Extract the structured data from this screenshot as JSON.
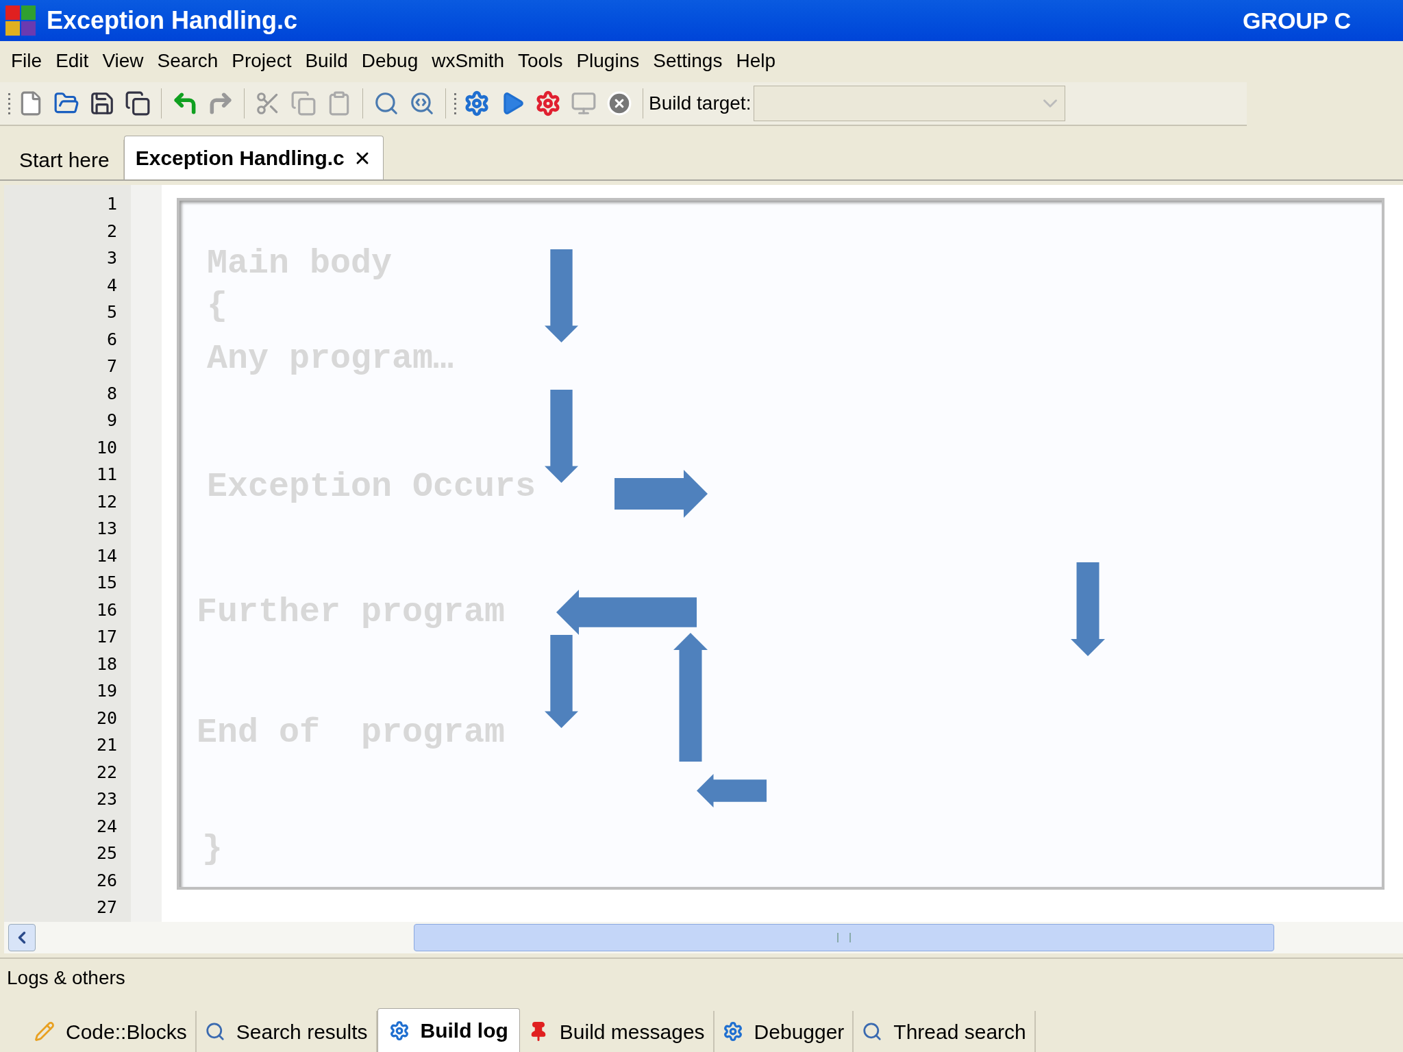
{
  "window": {
    "title": "Exception Handling.c",
    "overlay_title": "GROUP C"
  },
  "menu": [
    "File",
    "Edit",
    "View",
    "Search",
    "Project",
    "Build",
    "Debug",
    "wxSmith",
    "Tools",
    "Plugins",
    "Settings",
    "Help"
  ],
  "toolbar": {
    "build_target_label": "Build target:"
  },
  "editor_tabs": [
    {
      "label": "Start here",
      "selected": false
    },
    {
      "label": "Exception Handling.c",
      "selected": true
    }
  ],
  "line_numbers": [
    "1",
    "2",
    "3",
    "4",
    "5",
    "6",
    "7",
    "8",
    "9",
    "10",
    "11",
    "12",
    "13",
    "14",
    "15",
    "16",
    "17",
    "18",
    "19",
    "20",
    "21",
    "22",
    "23",
    "24",
    "25",
    "26",
    "27"
  ],
  "slide_lines": [
    "Main body",
    "{",
    "Any program…",
    "Exception Occurs",
    "Further program",
    "End of  program",
    "}"
  ],
  "logs_panel": {
    "title": "Logs & others",
    "tabs": [
      {
        "label": "Code::Blocks",
        "selected": false
      },
      {
        "label": "Search results",
        "selected": false
      },
      {
        "label": "Build log",
        "selected": true
      },
      {
        "label": "Build messages",
        "selected": false
      },
      {
        "label": "Debugger",
        "selected": false
      },
      {
        "label": "Thread search",
        "selected": false
      }
    ]
  }
}
